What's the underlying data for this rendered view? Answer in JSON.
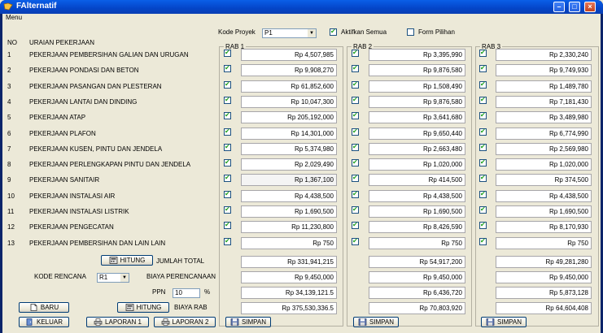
{
  "window": {
    "title": "FAlternatif"
  },
  "menu": {
    "label": "Menu"
  },
  "header": {
    "kode_proyek_label": "Kode Proyek",
    "kode_proyek_value": "P1",
    "aktifkan_semua_label": "Aktifkan Semua",
    "aktifkan_semua_checked": true,
    "form_pilihan_label": "Form Pilihan",
    "form_pilihan_checked": false
  },
  "columns": {
    "no": "NO",
    "uraian": "URAIAN PEKERJAAN"
  },
  "jobs": [
    {
      "no": "1",
      "name": "PEKERJAAN PEMBERSIHAN GALIAN  DAN URUGAN"
    },
    {
      "no": "2",
      "name": "PEKERJAAN PONDASI DAN BETON"
    },
    {
      "no": "3",
      "name": "PEKERJAAN PASANGAN DAN PLESTERAN"
    },
    {
      "no": "4",
      "name": "PEKERJAAN LANTAI DAN DINDING"
    },
    {
      "no": "5",
      "name": "PEKERJAAN ATAP"
    },
    {
      "no": "6",
      "name": "PEKERJAAN PLAFON"
    },
    {
      "no": "7",
      "name": "PEKERJAAN KUSEN, PINTU DAN JENDELA"
    },
    {
      "no": "8",
      "name": "PEKERJAAN PERLENGKAPAN PINTU DAN JENDELA"
    },
    {
      "no": "9",
      "name": "PEKERJAAN SANITAIR"
    },
    {
      "no": "10",
      "name": "PEKERJAAN INSTALASI AIR"
    },
    {
      "no": "11",
      "name": "PEKERJAAN INSTALASI LISTRIK"
    },
    {
      "no": "12",
      "name": "PEKERJAAN PENGECATAN"
    },
    {
      "no": "13",
      "name": "PEKERJAAN PEMBERSIHAN DAN LAIN LAIN"
    }
  ],
  "rab": [
    {
      "label": "RAB 1",
      "values": [
        "Rp 4,507,985",
        "Rp 9,908,270",
        "Rp 61,852,600",
        "Rp 10,047,300",
        "Rp 205,192,000",
        "Rp 14,301,000",
        "Rp 5,374,980",
        "Rp 2,029,490",
        "Rp 1,367,100",
        "Rp 4,438,500",
        "Rp 1,690,500",
        "Rp 11,230,800",
        "Rp 750"
      ],
      "checked": [
        true,
        true,
        true,
        true,
        true,
        true,
        true,
        true,
        true,
        true,
        true,
        true,
        true
      ],
      "jumlah_total": "Rp 331,941,215",
      "biaya_perencanaan": "Rp 9,450,000",
      "ppn": "Rp 34,139,121.5",
      "biaya_rab": "Rp 375,530,336.5",
      "simpan_label": "SIMPAN"
    },
    {
      "label": "RAB 2",
      "values": [
        "Rp 3,395,990",
        "Rp 9,876,580",
        "Rp 1,508,490",
        "Rp 9,876,580",
        "Rp 3,641,680",
        "Rp 9,650,440",
        "Rp 2,663,480",
        "Rp 1,020,000",
        "Rp 414,500",
        "Rp 4,438,500",
        "Rp 1,690,500",
        "Rp 8,426,590",
        "Rp 750"
      ],
      "checked": [
        true,
        true,
        true,
        true,
        true,
        true,
        true,
        true,
        true,
        true,
        true,
        true,
        true
      ],
      "jumlah_total": "Rp 54,917,200",
      "biaya_perencanaan": "Rp 9,450,000",
      "ppn": "Rp 6,436,720",
      "biaya_rab": "Rp 70,803,920",
      "simpan_label": "SIMPAN"
    },
    {
      "label": "RAB 3",
      "values": [
        "Rp 2,330,240",
        "Rp 9,749,930",
        "Rp 1,489,780",
        "Rp 7,181,430",
        "Rp 3,489,980",
        "Rp 6,774,990",
        "Rp 2,569,980",
        "Rp 1,020,000",
        "Rp 374,500",
        "Rp 4,438,500",
        "Rp 1,690,500",
        "Rp 8,170,930",
        "Rp 750"
      ],
      "checked": [
        true,
        true,
        true,
        true,
        true,
        true,
        true,
        true,
        true,
        true,
        true,
        true,
        true
      ],
      "jumlah_total": "Rp 49,281,280",
      "biaya_perencanaan": "Rp 9,450,000",
      "ppn": "Rp 5,873,128",
      "biaya_rab": "Rp 64,604,408",
      "simpan_label": "SIMPAN"
    }
  ],
  "controls": {
    "hitung_total_label": "HITUNG",
    "jumlah_total_label": "JUMLAH TOTAL",
    "kode_rencana_label": "KODE RENCANA",
    "kode_rencana_value": "R1",
    "biaya_perencanaan_label": "BIAYA PERENCANAAN",
    "ppn_label": "PPN",
    "ppn_value": "10",
    "ppn_unit": "%",
    "hitung_rab_label": "HITUNG",
    "biaya_rab_label": "BIAYA RAB",
    "baru_label": "BARU",
    "keluar_label": "KELUAR",
    "laporan1_label": "LAPORAN 1",
    "laporan2_label": "LAPORAN 2"
  },
  "colors": {
    "titlebar": "#0a5fe8",
    "face": "#ece9d8",
    "check": "#21a121"
  }
}
